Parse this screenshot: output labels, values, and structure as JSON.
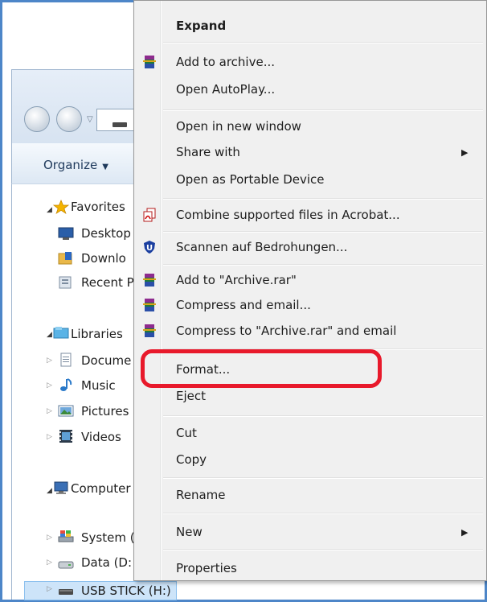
{
  "explorer": {
    "organize_label": "Organize",
    "tree": {
      "favorites": "Favorites",
      "desktop": "Desktop",
      "downloads": "Downlo",
      "recent": "Recent P",
      "libraries": "Libraries",
      "documents": "Docume",
      "music": "Music",
      "pictures": "Pictures",
      "videos": "Videos",
      "computer": "Computer",
      "system": "System (",
      "data": "Data (D:",
      "usb": "USB STICK (H:)"
    }
  },
  "context_menu": {
    "items": [
      {
        "label": "Expand",
        "bold": true
      },
      {
        "label": "Add to archive...",
        "icon": "winrar-icon"
      },
      {
        "label": "Open AutoPlay..."
      },
      {
        "label": "Open in new window"
      },
      {
        "label": "Share with",
        "submenu": true
      },
      {
        "label": "Open as Portable Device"
      },
      {
        "label": "Combine supported files in Acrobat...",
        "icon": "acrobat-icon"
      },
      {
        "label": "Scannen auf Bedrohungen...",
        "icon": "antivirus-shield-icon"
      },
      {
        "label": "Add to \"Archive.rar\"",
        "icon": "winrar-icon"
      },
      {
        "label": "Compress and email...",
        "icon": "winrar-icon"
      },
      {
        "label": "Compress to \"Archive.rar\" and email",
        "icon": "winrar-icon"
      },
      {
        "label": "Format..."
      },
      {
        "label": "Eject"
      },
      {
        "label": "Cut"
      },
      {
        "label": "Copy"
      },
      {
        "label": "Rename"
      },
      {
        "label": "New",
        "submenu": true
      },
      {
        "label": "Properties"
      }
    ]
  },
  "colors": {
    "highlight_outline": "#e8192b",
    "frame": "#4d86c8",
    "selected_row": "#cde4f9"
  }
}
